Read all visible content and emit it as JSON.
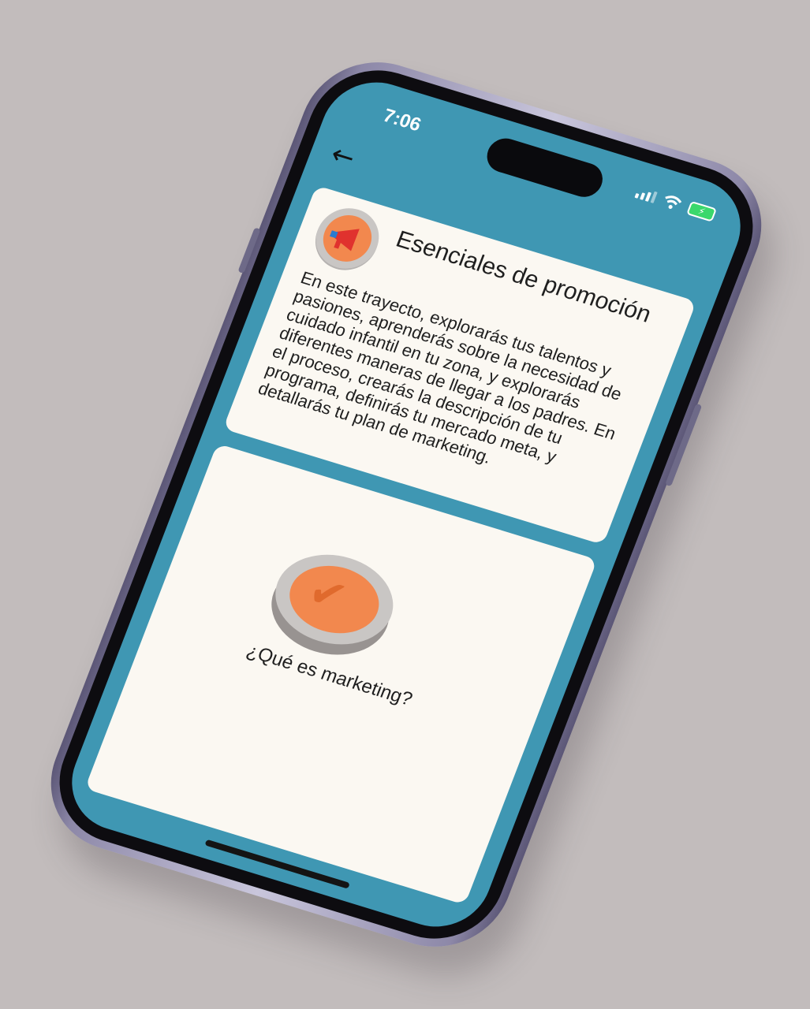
{
  "status_bar": {
    "time": "7:06",
    "battery_icon": "battery-charging-icon"
  },
  "nav": {
    "back_icon": "arrow-left-icon",
    "back_glyph": "←"
  },
  "course": {
    "icon": "megaphone-icon",
    "title": "Esenciales de promoción",
    "description": "En este trayecto, explorarás tus talentos y pasiones, aprenderás sobre la necesidad de cuidado infantil en tu zona, y explorarás diferentes maneras de llegar a los padres. En el proceso, crearás la descripción de tu programa, definirás tu mercado meta, y detallarás tu plan de marketing."
  },
  "lessons": [
    {
      "label": "¿Qué es marketing?",
      "state": "completed",
      "icon": "checkmark-icon"
    },
    {
      "label": "",
      "state": "locked"
    }
  ],
  "colors": {
    "header_bg": "#3f97b3",
    "card_bg": "#fbf8f2",
    "accent_orange": "#f2884e",
    "coin_gray": "#c9c6c4"
  }
}
